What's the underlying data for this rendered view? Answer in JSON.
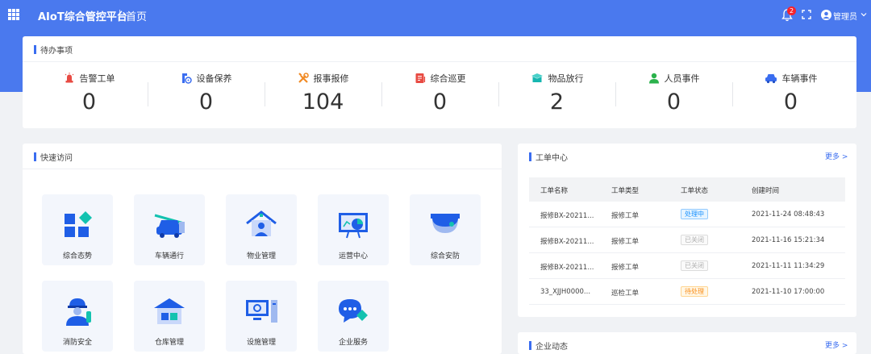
{
  "header": {
    "app_title": "AIoT综合管控平台",
    "breadcrumb": "首页",
    "notification_count": "2",
    "user_name": "管理员"
  },
  "todo": {
    "title": "待办事项",
    "items": [
      {
        "label": "告警工单",
        "count": "0",
        "icon": "alarm-icon",
        "color": "#e84b43"
      },
      {
        "label": "设备保养",
        "count": "0",
        "icon": "device-maintenance-icon",
        "color": "#3a6df0"
      },
      {
        "label": "报事报修",
        "count": "104",
        "icon": "repair-tools-icon",
        "color": "#f08a24"
      },
      {
        "label": "综合巡更",
        "count": "0",
        "icon": "patrol-notebook-icon",
        "color": "#e84b43"
      },
      {
        "label": "物品放行",
        "count": "2",
        "icon": "goods-box-icon",
        "color": "#16b6b0"
      },
      {
        "label": "人员事件",
        "count": "0",
        "icon": "person-icon",
        "color": "#2bb24c"
      },
      {
        "label": "车辆事件",
        "count": "0",
        "icon": "car-icon",
        "color": "#3a6df0"
      }
    ]
  },
  "quick": {
    "title": "快速访问",
    "tiles": [
      {
        "label": "综合态势",
        "icon": "overview-blocks-icon"
      },
      {
        "label": "车辆通行",
        "icon": "vehicle-pass-icon"
      },
      {
        "label": "物业管理",
        "icon": "property-house-icon"
      },
      {
        "label": "运营中心",
        "icon": "operation-board-icon"
      },
      {
        "label": "综合安防",
        "icon": "security-camera-icon"
      },
      {
        "label": "消防安全",
        "icon": "firefighter-icon"
      },
      {
        "label": "仓库管理",
        "icon": "warehouse-icon"
      },
      {
        "label": "设施管理",
        "icon": "facility-computer-icon"
      },
      {
        "label": "企业服务",
        "icon": "service-chat-icon"
      }
    ]
  },
  "orders": {
    "title": "工单中心",
    "more": "更多 >",
    "columns": [
      "工单名称",
      "工单类型",
      "工单状态",
      "创建时间"
    ],
    "rows": [
      {
        "name": "报修BX-20211...",
        "type": "报修工单",
        "status": "处理中",
        "status_kind": "processing",
        "time": "2021-11-24 08:48:43"
      },
      {
        "name": "报修BX-20211...",
        "type": "报修工单",
        "status": "已关闭",
        "status_kind": "closed",
        "time": "2021-11-16 15:21:34"
      },
      {
        "name": "报修BX-20211...",
        "type": "报修工单",
        "status": "已关闭",
        "status_kind": "closed",
        "time": "2021-11-11 11:34:29"
      },
      {
        "name": "33_XJJH0000...",
        "type": "巡检工单",
        "status": "待处理",
        "status_kind": "pending",
        "time": "2021-11-10 17:00:00"
      }
    ]
  },
  "news": {
    "title": "企业动态",
    "more": "更多 >"
  },
  "colors": {
    "header_bg": "#4a79ee",
    "accent": "#3a6df0",
    "processing": "#1890ff",
    "closed": "#b0b0b0",
    "pending": "#fa8c16"
  }
}
